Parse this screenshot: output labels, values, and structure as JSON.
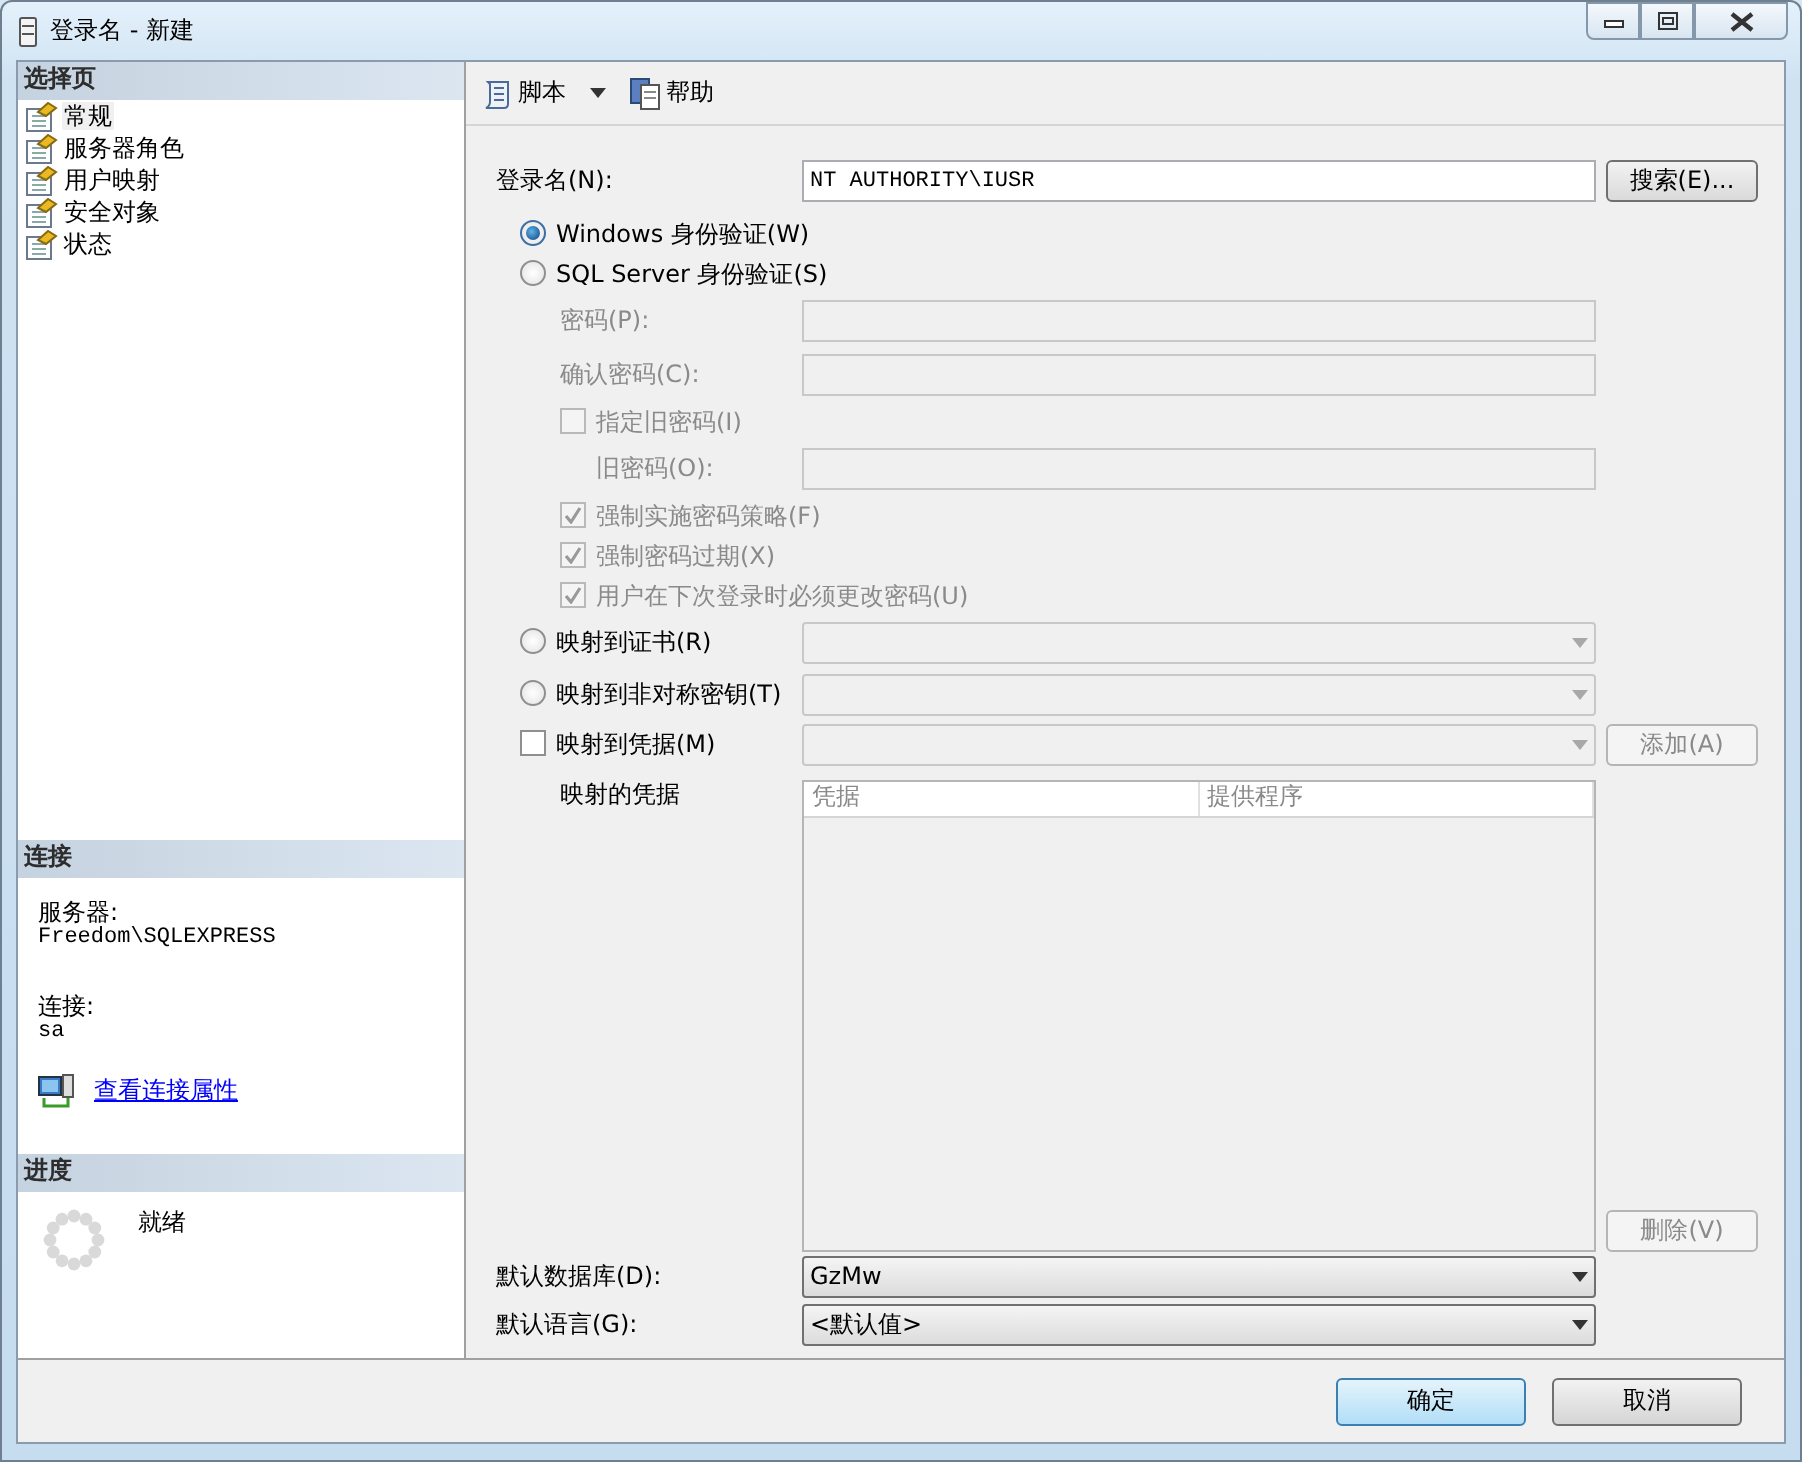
{
  "window": {
    "title": "登录名 - 新建"
  },
  "sidebar": {
    "header": "选择页",
    "items": [
      {
        "label": "常规",
        "selected": true
      },
      {
        "label": "服务器角色",
        "selected": false
      },
      {
        "label": "用户映射",
        "selected": false
      },
      {
        "label": "安全对象",
        "selected": false
      },
      {
        "label": "状态",
        "selected": false
      }
    ]
  },
  "connection": {
    "header": "连接",
    "server_label": "服务器:",
    "server": "Freedom\\SQLEXPRESS",
    "connection_label": "连接:",
    "connection": "sa",
    "link": "查看连接属性"
  },
  "progress": {
    "header": "进度",
    "status": "就绪"
  },
  "toolbar": {
    "items": [
      {
        "label": "脚本",
        "kind": "script"
      },
      {
        "label": "帮助",
        "kind": "help"
      }
    ]
  },
  "form": {
    "rows": [
      {
        "kind": "text",
        "label": "登录名(N):",
        "value": "NT AUTHORITY\\IUSR",
        "button": {
          "label": "搜索(E)...",
          "disabled": false
        }
      },
      {
        "kind": "radio",
        "label": "Windows 身份验证(W)",
        "selected": true,
        "disabled": false
      },
      {
        "kind": "radio",
        "label": "SQL Server 身份验证(S)",
        "selected": false,
        "disabled": false,
        "children": [
          {
            "kind": "password",
            "label": "密码(P):",
            "disabled": true
          },
          {
            "kind": "password",
            "label": "确认密码(C):",
            "disabled": true
          },
          {
            "kind": "checkbox",
            "label": "指定旧密码(I)",
            "checked": false,
            "disabled": true,
            "children": [
              {
                "kind": "password",
                "label": "旧密码(O):",
                "disabled": true
              }
            ]
          },
          {
            "kind": "checkbox",
            "label": "强制实施密码策略(F)",
            "checked": true,
            "disabled": true
          },
          {
            "kind": "checkbox",
            "label": "强制密码过期(X)",
            "checked": true,
            "disabled": true
          },
          {
            "kind": "checkbox",
            "label": "用户在下次登录时必须更改密码(U)",
            "checked": true,
            "disabled": true
          }
        ]
      },
      {
        "kind": "radio-select",
        "label": "映射到证书(R)",
        "selected": false,
        "disabled": false,
        "field_disabled": true
      },
      {
        "kind": "radio-select",
        "label": "映射到非对称密钥(T)",
        "selected": false,
        "disabled": false,
        "field_disabled": true
      },
      {
        "kind": "checkbox-select",
        "label": "映射到凭据(M)",
        "checked": false,
        "disabled": false,
        "field_disabled": true,
        "button": {
          "label": "添加(A)",
          "disabled": true
        }
      },
      {
        "kind": "table",
        "label": "映射的凭据",
        "columns": [
          "凭据",
          "提供程序"
        ],
        "button": {
          "label": "删除(V)",
          "disabled": true
        }
      },
      {
        "kind": "select",
        "label": "默认数据库(D):",
        "value": "GzMw"
      },
      {
        "kind": "select",
        "label": "默认语言(G):",
        "value": "<默认值>"
      }
    ]
  },
  "buttons": [
    {
      "label": "确定",
      "default": true
    },
    {
      "label": "取消",
      "default": false
    }
  ]
}
